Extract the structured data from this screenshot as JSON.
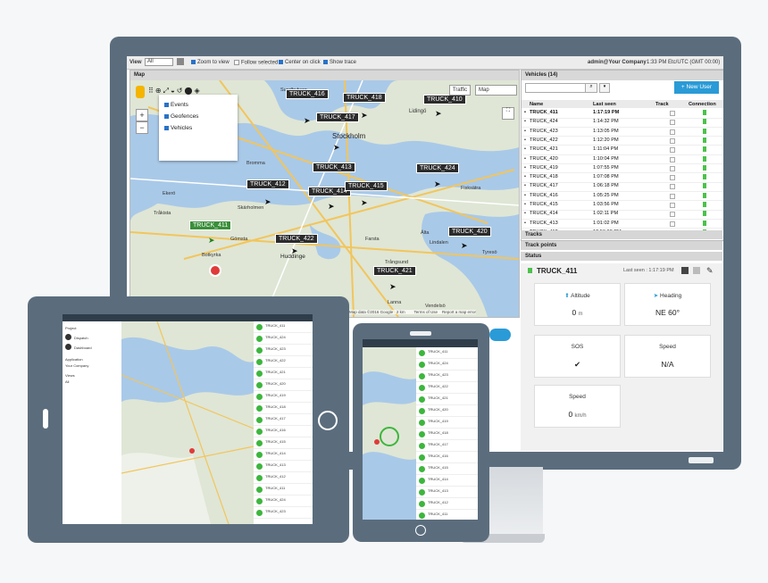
{
  "topbar": {
    "view_label": "View",
    "view_select": "All",
    "options": [
      {
        "label": "Zoom to view",
        "checked": true
      },
      {
        "label": "Follow selected",
        "checked": false
      },
      {
        "label": "Center on click",
        "checked": true
      },
      {
        "label": "Show trace",
        "checked": true
      }
    ],
    "user": "admin@Your Company",
    "time": "1:33 PM Etc/UTC (GMT 00:00)"
  },
  "map_panel": {
    "title": "Map",
    "layers": [
      "Events",
      "Geofences",
      "Vehicles"
    ],
    "traffic_label": "Traffic",
    "maptype_label": "Map",
    "zoom_in": "+",
    "zoom_out": "−",
    "attribution": "Map data ©2016 Google   2 km        Terms of Use    Report a map error",
    "truck_labels": [
      "TRUCK_416",
      "TRUCK_418",
      "TRUCK_410",
      "TRUCK_417",
      "TRUCK_413",
      "TRUCK_424",
      "TRUCK_412",
      "TRUCK_414",
      "TRUCK_415",
      "TRUCK_411",
      "TRUCK_422",
      "TRUCK_420",
      "TRUCK_421"
    ],
    "places": [
      "Stockholm",
      "Lidingö",
      "Huddinge",
      "Botkyrka",
      "Gömsta",
      "Tyresö",
      "Lindalen",
      "Farsta",
      "Sundbyberg",
      "Ekerö",
      "Fisksätra",
      "Trångsund",
      "Skärholmen",
      "Älta",
      "Lanna",
      "Vendelsö",
      "Tråkista",
      "Bromma"
    ]
  },
  "vehicles": {
    "title": "Vehicles (14)",
    "new_user_button": "+ New User",
    "search_placeholder": "",
    "columns": [
      "Name",
      "Last seen",
      "Track",
      "Connection"
    ],
    "rows": [
      {
        "name": "TRUCK_411",
        "last_seen": "1:17:19 PM"
      },
      {
        "name": "TRUCK_424",
        "last_seen": "1:14:32 PM"
      },
      {
        "name": "TRUCK_423",
        "last_seen": "1:13:05 PM"
      },
      {
        "name": "TRUCK_422",
        "last_seen": "1:12:20 PM"
      },
      {
        "name": "TRUCK_421",
        "last_seen": "1:11:04 PM"
      },
      {
        "name": "TRUCK_420",
        "last_seen": "1:10:04 PM"
      },
      {
        "name": "TRUCK_419",
        "last_seen": "1:07:55 PM"
      },
      {
        "name": "TRUCK_418",
        "last_seen": "1:07:08 PM"
      },
      {
        "name": "TRUCK_417",
        "last_seen": "1:06:18 PM"
      },
      {
        "name": "TRUCK_416",
        "last_seen": "1:05:25 PM"
      },
      {
        "name": "TRUCK_415",
        "last_seen": "1:03:56 PM"
      },
      {
        "name": "TRUCK_414",
        "last_seen": "1:02:11 PM"
      },
      {
        "name": "TRUCK_413",
        "last_seen": "1:01:02 PM"
      },
      {
        "name": "TRUCK_412",
        "last_seen": "12:56:08 PM"
      }
    ]
  },
  "sections": {
    "tracks": "Tracks",
    "track_points": "Track points",
    "status": "Status"
  },
  "status": {
    "vehicle": "TRUCK_411",
    "last_seen": "Last seen : 1:17:19 PM",
    "cards": [
      {
        "label": "Altitude",
        "value": "0",
        "unit": "m"
      },
      {
        "label": "Heading",
        "value": "NE 60°",
        "unit": ""
      },
      {
        "label": "SOS",
        "value": "✔",
        "unit": ""
      },
      {
        "label": "Speed",
        "value": "N/A",
        "unit": ""
      },
      {
        "label": "Speed",
        "value": "0",
        "unit": "km/h"
      }
    ]
  },
  "tablet": {
    "sidebar": [
      "Project",
      "Dispatch",
      "Dashboard",
      "Application",
      "Your Company",
      "Views",
      "All"
    ]
  },
  "colors": {
    "device": "#5b6d7d",
    "accent": "#2a9bd7",
    "green": "#4bc24b",
    "map_water": "#a9c9e8",
    "map_land": "#dfe6d5"
  }
}
